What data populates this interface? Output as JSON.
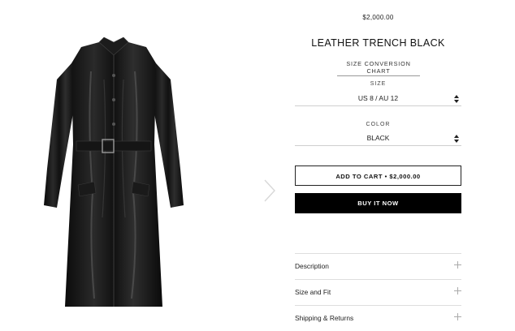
{
  "product": {
    "image_icon": "leather-trench-coat-image",
    "price": "$2,000.00",
    "title": "LEATHER TRENCH BLACK",
    "size_chart_link": "SIZE CONVERSION CHART"
  },
  "options": {
    "size": {
      "label": "SIZE",
      "value": "US 8 / AU 12"
    },
    "color": {
      "label": "COLOR",
      "value": "BLACK"
    }
  },
  "actions": {
    "add_to_cart": "ADD TO CART • $2,000.00",
    "buy_now": "BUY IT NOW"
  },
  "accordion": [
    {
      "label": "Description"
    },
    {
      "label": "Size and Fit"
    },
    {
      "label": "Shipping & Returns"
    }
  ],
  "navigation": {
    "next_icon": "chevron-right-icon"
  },
  "colors": {
    "background": "#ffffff",
    "text": "#111111",
    "buy_button": "#000000",
    "divider": "#dedede"
  }
}
